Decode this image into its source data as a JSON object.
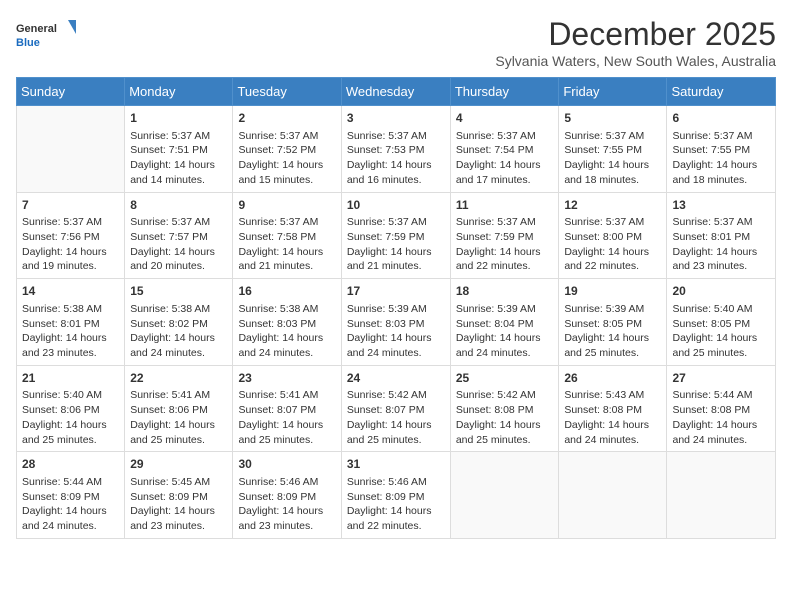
{
  "logo": {
    "general": "General",
    "blue": "Blue"
  },
  "title": "December 2025",
  "subtitle": "Sylvania Waters, New South Wales, Australia",
  "headers": [
    "Sunday",
    "Monday",
    "Tuesday",
    "Wednesday",
    "Thursday",
    "Friday",
    "Saturday"
  ],
  "weeks": [
    [
      {
        "day": "",
        "content": ""
      },
      {
        "day": "1",
        "content": "Sunrise: 5:37 AM\nSunset: 7:51 PM\nDaylight: 14 hours and 14 minutes."
      },
      {
        "day": "2",
        "content": "Sunrise: 5:37 AM\nSunset: 7:52 PM\nDaylight: 14 hours and 15 minutes."
      },
      {
        "day": "3",
        "content": "Sunrise: 5:37 AM\nSunset: 7:53 PM\nDaylight: 14 hours and 16 minutes."
      },
      {
        "day": "4",
        "content": "Sunrise: 5:37 AM\nSunset: 7:54 PM\nDaylight: 14 hours and 17 minutes."
      },
      {
        "day": "5",
        "content": "Sunrise: 5:37 AM\nSunset: 7:55 PM\nDaylight: 14 hours and 18 minutes."
      },
      {
        "day": "6",
        "content": "Sunrise: 5:37 AM\nSunset: 7:55 PM\nDaylight: 14 hours and 18 minutes."
      }
    ],
    [
      {
        "day": "7",
        "content": "Sunrise: 5:37 AM\nSunset: 7:56 PM\nDaylight: 14 hours and 19 minutes."
      },
      {
        "day": "8",
        "content": "Sunrise: 5:37 AM\nSunset: 7:57 PM\nDaylight: 14 hours and 20 minutes."
      },
      {
        "day": "9",
        "content": "Sunrise: 5:37 AM\nSunset: 7:58 PM\nDaylight: 14 hours and 21 minutes."
      },
      {
        "day": "10",
        "content": "Sunrise: 5:37 AM\nSunset: 7:59 PM\nDaylight: 14 hours and 21 minutes."
      },
      {
        "day": "11",
        "content": "Sunrise: 5:37 AM\nSunset: 7:59 PM\nDaylight: 14 hours and 22 minutes."
      },
      {
        "day": "12",
        "content": "Sunrise: 5:37 AM\nSunset: 8:00 PM\nDaylight: 14 hours and 22 minutes."
      },
      {
        "day": "13",
        "content": "Sunrise: 5:37 AM\nSunset: 8:01 PM\nDaylight: 14 hours and 23 minutes."
      }
    ],
    [
      {
        "day": "14",
        "content": "Sunrise: 5:38 AM\nSunset: 8:01 PM\nDaylight: 14 hours and 23 minutes."
      },
      {
        "day": "15",
        "content": "Sunrise: 5:38 AM\nSunset: 8:02 PM\nDaylight: 14 hours and 24 minutes."
      },
      {
        "day": "16",
        "content": "Sunrise: 5:38 AM\nSunset: 8:03 PM\nDaylight: 14 hours and 24 minutes."
      },
      {
        "day": "17",
        "content": "Sunrise: 5:39 AM\nSunset: 8:03 PM\nDaylight: 14 hours and 24 minutes."
      },
      {
        "day": "18",
        "content": "Sunrise: 5:39 AM\nSunset: 8:04 PM\nDaylight: 14 hours and 24 minutes."
      },
      {
        "day": "19",
        "content": "Sunrise: 5:39 AM\nSunset: 8:05 PM\nDaylight: 14 hours and 25 minutes."
      },
      {
        "day": "20",
        "content": "Sunrise: 5:40 AM\nSunset: 8:05 PM\nDaylight: 14 hours and 25 minutes."
      }
    ],
    [
      {
        "day": "21",
        "content": "Sunrise: 5:40 AM\nSunset: 8:06 PM\nDaylight: 14 hours and 25 minutes."
      },
      {
        "day": "22",
        "content": "Sunrise: 5:41 AM\nSunset: 8:06 PM\nDaylight: 14 hours and 25 minutes."
      },
      {
        "day": "23",
        "content": "Sunrise: 5:41 AM\nSunset: 8:07 PM\nDaylight: 14 hours and 25 minutes."
      },
      {
        "day": "24",
        "content": "Sunrise: 5:42 AM\nSunset: 8:07 PM\nDaylight: 14 hours and 25 minutes."
      },
      {
        "day": "25",
        "content": "Sunrise: 5:42 AM\nSunset: 8:08 PM\nDaylight: 14 hours and 25 minutes."
      },
      {
        "day": "26",
        "content": "Sunrise: 5:43 AM\nSunset: 8:08 PM\nDaylight: 14 hours and 24 minutes."
      },
      {
        "day": "27",
        "content": "Sunrise: 5:44 AM\nSunset: 8:08 PM\nDaylight: 14 hours and 24 minutes."
      }
    ],
    [
      {
        "day": "28",
        "content": "Sunrise: 5:44 AM\nSunset: 8:09 PM\nDaylight: 14 hours and 24 minutes."
      },
      {
        "day": "29",
        "content": "Sunrise: 5:45 AM\nSunset: 8:09 PM\nDaylight: 14 hours and 23 minutes."
      },
      {
        "day": "30",
        "content": "Sunrise: 5:46 AM\nSunset: 8:09 PM\nDaylight: 14 hours and 23 minutes."
      },
      {
        "day": "31",
        "content": "Sunrise: 5:46 AM\nSunset: 8:09 PM\nDaylight: 14 hours and 22 minutes."
      },
      {
        "day": "",
        "content": ""
      },
      {
        "day": "",
        "content": ""
      },
      {
        "day": "",
        "content": ""
      }
    ]
  ]
}
